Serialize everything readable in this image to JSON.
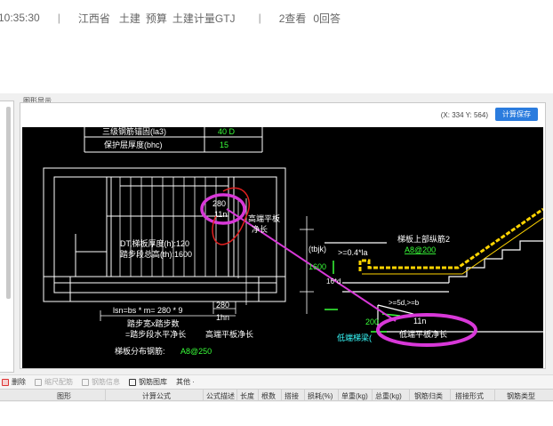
{
  "meta": {
    "time": "10:35:30",
    "sep": "|",
    "tags": [
      "江西省",
      "土建",
      "预算",
      "土建计量GTJ"
    ],
    "views": "2查看",
    "answers": "0回答"
  },
  "panel": {
    "title": "图形显示",
    "coords": "(X: 334 Y: 564)",
    "save_label": "计算保存"
  },
  "drawing": {
    "table_rows": [
      {
        "label": "三级钢筋锚固(la3)",
        "value": "40 D"
      },
      {
        "label": "保护层厚度(bhc)",
        "value": "15"
      }
    ],
    "labels": {
      "dt_thick": "DT,梯板厚度(h):120",
      "step_h": "踏步段总高(th):1600",
      "d280": "280",
      "l1n_top": "11n",
      "high_plat_1": "高端平板",
      "high_plat_2": "净长",
      "tbjk": "(tbjk)",
      "dim_1600": "1600",
      "half_la": ">=0.4*la",
      "upper_bar": "梯板上部纵筋2",
      "upper_bar_val": "A8@200",
      "d16d": "16*d",
      "d5d": ">=5d,>=b",
      "d200": "200",
      "l1n_bot": "11n",
      "low_beam": "低端梯梁(",
      "low_plat": "低端平板净长",
      "formula": "lsn=bs * m= 280 * 9",
      "d280b": "280",
      "l1n_mid": "1hn",
      "step_w": "踏步宽x踏步数",
      "step_eq": "=踏步段水平净长",
      "high_len": "高端平板净长",
      "dist_bar": "梯板分布钢筋:",
      "dist_bar_val": "A8@250"
    }
  },
  "toolbar": {
    "items": [
      {
        "label": "删除",
        "enabled": true
      },
      {
        "label": "缩尺配筋",
        "enabled": false
      },
      {
        "label": "钢筋信息",
        "enabled": false
      },
      {
        "label": "钢筋图库",
        "enabled": true
      },
      {
        "label": "其他 ·",
        "enabled": true
      }
    ]
  },
  "table": {
    "columns": [
      "图形",
      "计算公式",
      "公式描述",
      "长度",
      "根数",
      "搭接",
      "损耗(%)",
      "单重(kg)",
      "总重(kg)",
      "钢筋归类",
      "搭接形式",
      "钢筋类型"
    ]
  },
  "colors": {
    "highlight": "#d838d8",
    "red_circle": "#e02020",
    "rebar": "#ffd400",
    "save_btn": "#2b7cde"
  }
}
